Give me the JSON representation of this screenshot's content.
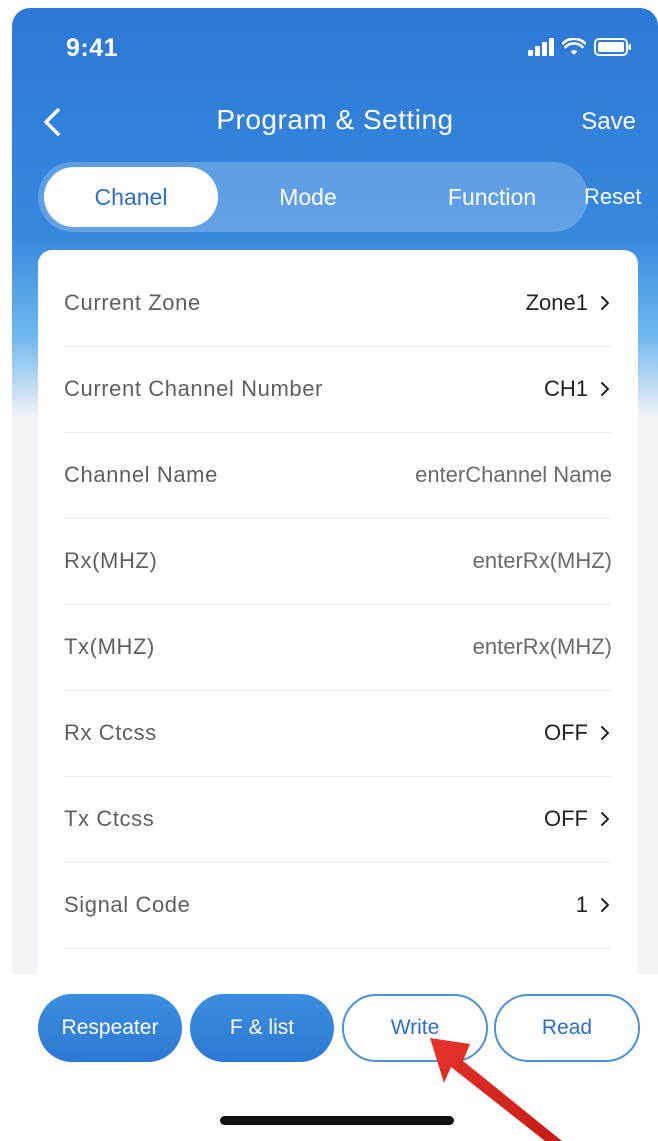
{
  "status_bar": {
    "time": "9:41"
  },
  "nav": {
    "title": "Program & Setting",
    "save_label": "Save"
  },
  "tabs": {
    "items": [
      {
        "label": "Chanel",
        "active": true
      },
      {
        "label": "Mode",
        "active": false
      },
      {
        "label": "Function",
        "active": false
      }
    ],
    "reset_label": "Reset"
  },
  "settings": {
    "rows": [
      {
        "label": "Current Zone",
        "value": "Zone1"
      },
      {
        "label": "Current Channel Number",
        "value": "CH1"
      },
      {
        "label": "Channel Name",
        "placeholder": "enterChannel Name"
      },
      {
        "label": "Rx(MHZ)",
        "placeholder": "enterRx(MHZ)"
      },
      {
        "label": "Tx(MHZ)",
        "placeholder": "enterRx(MHZ)"
      },
      {
        "label": "Rx Ctcss",
        "value": "OFF"
      },
      {
        "label": "Tx Ctcss",
        "value": "OFF"
      },
      {
        "label": "Signal Code",
        "value": "1"
      }
    ]
  },
  "bottom_actions": {
    "respeater_label": "Respeater",
    "flist_label": "F & list",
    "write_label": "Write",
    "read_label": "Read"
  },
  "colors": {
    "primary_blue": "#2e78d3",
    "arrow_red": "#d9241c"
  }
}
